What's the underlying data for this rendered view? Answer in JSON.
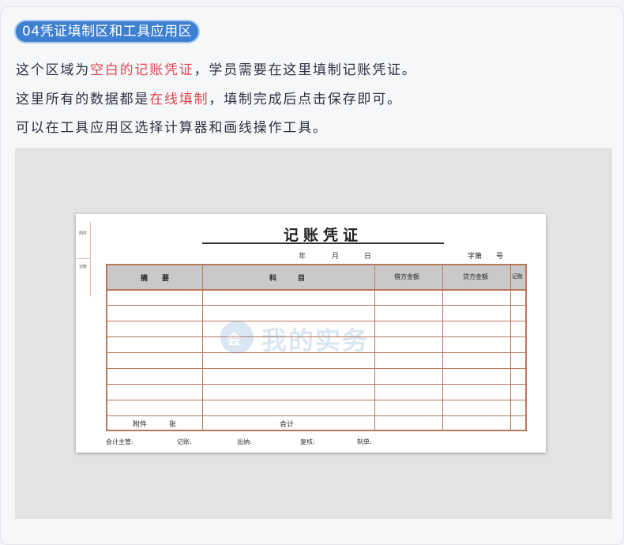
{
  "section_tag": "04凭证填制区和工具应用区",
  "lines": [
    {
      "pre": "这个区域为",
      "highlight": "空白的记账凭证",
      "post": "，学员需要在这里填制记账凭证。"
    },
    {
      "pre": "这里所有的数据都是",
      "highlight": "在线填制",
      "post": "，填制完成后点击保存即可。"
    },
    {
      "text": "可以在工具应用区选择计算器和画线操作工具。"
    }
  ],
  "voucher": {
    "title": "记账凭证",
    "date": {
      "year": "年",
      "month": "月",
      "day": "日"
    },
    "number_prefix": "字第",
    "number_suffix": "号",
    "stub_top": "附件",
    "stub_bottom": "记账",
    "headers": {
      "summary": "摘　　要",
      "account": "科　　　目",
      "debit": "借方金额",
      "credit": "贷方金额",
      "posted": "记账"
    },
    "footer": {
      "attach": "附件",
      "sheet": "张",
      "total": "合计"
    },
    "signatures": {
      "supervisor": "会计主管:",
      "bookkeeper": "记账:",
      "cashier": "出纳:",
      "reviewer": "复核:",
      "maker": "制单:"
    },
    "watermark": {
      "icon": "会",
      "text": "我的实务"
    },
    "colors": {
      "border": "#b9785a",
      "header_bg": "#c9c9c9"
    }
  },
  "colors": {
    "accent": "#3d7fd1",
    "highlight": "#e0484f"
  }
}
